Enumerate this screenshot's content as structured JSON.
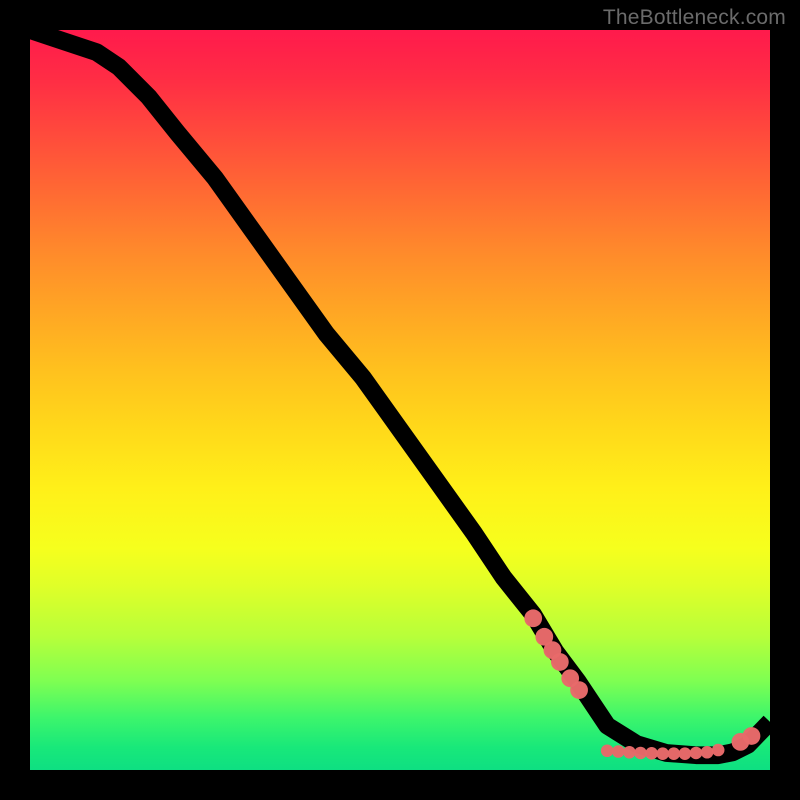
{
  "attribution": "TheBottleneck.com",
  "colors": {
    "background": "#000000",
    "curve": "#000000",
    "marker": "#e86a6a"
  },
  "chart_data": {
    "type": "line",
    "title": "",
    "xlabel": "",
    "ylabel": "",
    "xlim": [
      0,
      100
    ],
    "ylim": [
      0,
      100
    ],
    "series": [
      {
        "name": "curve",
        "x": [
          0,
          3,
          6,
          9,
          12,
          16,
          20,
          25,
          30,
          35,
          40,
          45,
          50,
          55,
          60,
          64,
          68,
          71,
          74,
          76,
          78,
          82,
          86,
          90,
          93,
          95,
          97,
          100
        ],
        "y": [
          100,
          99,
          98,
          97,
          95,
          91,
          86,
          80,
          73,
          66,
          59,
          53,
          46,
          39,
          32,
          26,
          21,
          16,
          12,
          9,
          6,
          3.5,
          2.3,
          2.0,
          2.0,
          2.4,
          3.4,
          6.5
        ]
      }
    ],
    "markers": [
      {
        "x": 68.0,
        "y": 20.5,
        "r": 1.2
      },
      {
        "x": 69.5,
        "y": 18.0,
        "r": 1.2
      },
      {
        "x": 70.6,
        "y": 16.2,
        "r": 1.2
      },
      {
        "x": 71.6,
        "y": 14.6,
        "r": 1.2
      },
      {
        "x": 73.0,
        "y": 12.4,
        "r": 1.2
      },
      {
        "x": 74.2,
        "y": 10.8,
        "r": 1.2
      },
      {
        "x": 78.0,
        "y": 2.6,
        "r": 0.85
      },
      {
        "x": 79.5,
        "y": 2.5,
        "r": 0.85
      },
      {
        "x": 81.0,
        "y": 2.4,
        "r": 0.85
      },
      {
        "x": 82.5,
        "y": 2.3,
        "r": 0.85
      },
      {
        "x": 84.0,
        "y": 2.25,
        "r": 0.85
      },
      {
        "x": 85.5,
        "y": 2.2,
        "r": 0.85
      },
      {
        "x": 87.0,
        "y": 2.2,
        "r": 0.85
      },
      {
        "x": 88.5,
        "y": 2.2,
        "r": 0.85
      },
      {
        "x": 90.0,
        "y": 2.3,
        "r": 0.85
      },
      {
        "x": 91.5,
        "y": 2.4,
        "r": 0.85
      },
      {
        "x": 93.0,
        "y": 2.7,
        "r": 0.85
      },
      {
        "x": 96.0,
        "y": 3.8,
        "r": 1.2
      },
      {
        "x": 97.5,
        "y": 4.6,
        "r": 1.2
      }
    ]
  }
}
